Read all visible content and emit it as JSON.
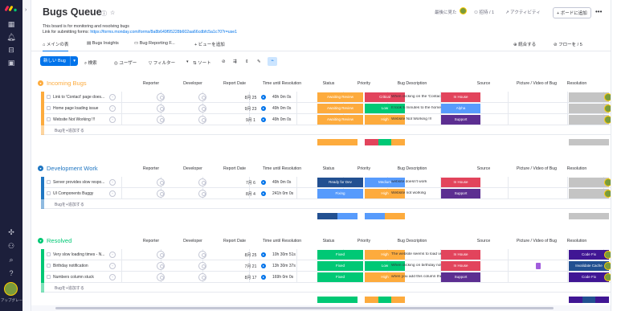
{
  "rail": {
    "avatar_text": "アップグレー…",
    "icons": [
      "apps-icon",
      "bell-icon",
      "inbox-icon",
      "calendar-icon",
      "puzzle-icon",
      "invite-icon",
      "search-icon",
      "help-icon"
    ]
  },
  "board": {
    "title": "Bugs Queue",
    "description_line1": "This board is for monitoring and resolving bugs",
    "description_line2_label": "Link for submitting forms:",
    "description_line2_link": "https://forms.monday.com/forms/8a8b649f95228b602aa66cdbfc5a1c70?r=use1",
    "last_seen_label": "最後に見た",
    "invite_label": "招待 / 1",
    "activity_label": "アクティビティ",
    "add_to_board_label": "+ ボードに追加",
    "more_label": "•••"
  },
  "tabs": {
    "items": [
      "メインの表",
      "Bugs Insights",
      "Bug Reporting F..."
    ],
    "add_view": "+ ビューを追加",
    "integrate": "統合する",
    "automation": "フローを / 5"
  },
  "toolbar": {
    "new_item": "新しい Bug",
    "search": "検索",
    "person": "ユーザー",
    "filter": "フィルター",
    "sort": "ソート"
  },
  "columns": [
    "Reporter",
    "Developer",
    "Report Date",
    "Time until Resolution",
    "Status",
    "Priority",
    "Bug Description",
    "Source",
    "Picture / Video of Bug",
    "Resolution",
    "La"
  ],
  "add_item_label": "Bugを+追加する",
  "colors": {
    "orange": "#fdab3d",
    "blue": "#0073ea",
    "green": "#00c875",
    "red": "#e2445c",
    "purple": "#784bd1",
    "darkblue": "#225091",
    "lightblue": "#579bfc",
    "yellow": "#ffcb00",
    "darkpurple": "#5c2e91",
    "indigo": "#401694",
    "grey": "#c4c4c4",
    "teal": "#1f76c2"
  },
  "groups": [
    {
      "title": "Incoming Bugs",
      "color": "#fdab3d",
      "rows": [
        {
          "name": "Link to 'Contact' page does...",
          "date": "8月 25",
          "time": "49h 0m 0s",
          "status": "Awaiting Review",
          "status_color": "#fdab3d",
          "priority": "Critical",
          "priority_color": "#e2445c",
          "desc": "When clicking on the 'Contact' link i...",
          "source": "In House",
          "source_color": "#e2445c",
          "resolution": "",
          "resolution_color": "#c4c4c4",
          "file": false
        },
        {
          "name": "Home page loading issue",
          "date": "9月 23",
          "time": "49h 0m 0s",
          "status": "Awaiting Review",
          "status_color": "#fdab3d",
          "priority": "Low",
          "priority_color": "#00c875",
          "desc": "It took 5 minutes to the home page t...",
          "source": "Alpha",
          "source_color": "#579bfc",
          "resolution": "",
          "resolution_color": "#c4c4c4",
          "file": false
        },
        {
          "name": "Website Not Working !!!",
          "date": "9月 1",
          "time": "49h 0m 0s",
          "status": "Awaiting Review",
          "status_color": "#fdab3d",
          "priority": "High",
          "priority_color": "#fdab3d",
          "desc": "Website Not Working !!!",
          "source": "Support",
          "source_color": "#5c2e91",
          "resolution": "",
          "resolution_color": "#c4c4c4",
          "file": false
        }
      ]
    },
    {
      "title": "Development Work",
      "color": "#1f76c2",
      "rows": [
        {
          "name": "Server provides slow respo...",
          "date": "7月 6",
          "time": "49h 0m 0s",
          "status": "Ready for Dev",
          "status_color": "#225091",
          "priority": "Medium",
          "priority_color": "#579bfc",
          "desc": "website doesn't work",
          "source": "In House",
          "source_color": "#e2445c",
          "resolution": "",
          "resolution_color": "#c4c4c4",
          "file": false
        },
        {
          "name": "UI Components Buggy",
          "date": "8月 4",
          "time": "241h 0m 0s",
          "status": "Fixing",
          "status_color": "#579bfc",
          "priority": "High",
          "priority_color": "#fdab3d",
          "desc": "Website not working",
          "source": "Support",
          "source_color": "#5c2e91",
          "resolution": "",
          "resolution_color": "#c4c4c4",
          "file": false
        }
      ]
    },
    {
      "title": "Resolved",
      "color": "#00c875",
      "rows": [
        {
          "name": "Very slow loading times - N...",
          "date": "8月 25",
          "time": "10h 30m 51s",
          "status": "Fixed",
          "status_color": "#00c875",
          "priority": "High",
          "priority_color": "#fdab3d",
          "desc": "The website seems to load very slow...",
          "source": "In House",
          "source_color": "#e2445c",
          "resolution": "Code Fix",
          "resolution_color": "#401694",
          "file": false
        },
        {
          "name": "Birthday notification",
          "date": "7月 21",
          "time": "13h 30m 37s",
          "status": "Fixed",
          "status_color": "#00c875",
          "priority": "Low",
          "priority_color": "#00c875",
          "desc": "When clicking on birthday notificatio...",
          "source": "In House",
          "source_color": "#e2445c",
          "resolution": "Invalidate Cache",
          "resolution_color": "#225091",
          "file": true
        },
        {
          "name": "Numbers column stuck",
          "date": "8月 17",
          "time": "169h 0m 0s",
          "status": "Fixed",
          "status_color": "#00c875",
          "priority": "High",
          "priority_color": "#fdab3d",
          "desc": "when you add this column the board ...",
          "source": "Support",
          "source_color": "#5c2e91",
          "resolution": "Code Fix",
          "resolution_color": "#401694",
          "file": false
        }
      ]
    }
  ]
}
